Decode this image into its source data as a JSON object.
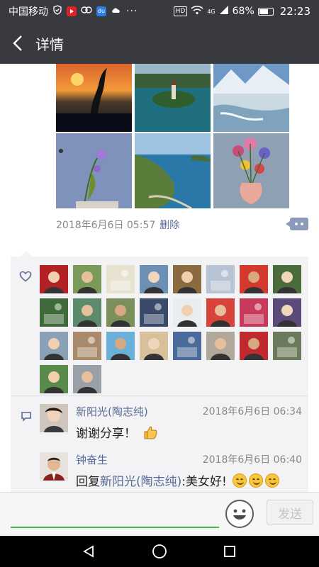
{
  "status_bar": {
    "carrier": "中国移动",
    "hd": "HD",
    "network": "4G",
    "battery": "68%",
    "battery_level": 0.68,
    "time": "22:23",
    "notification_icons": [
      "shield-check-icon",
      "video-app-icon",
      "link-app-icon",
      "baidu-app-icon",
      "weather-app-icon",
      "more-dots-icon"
    ]
  },
  "nav": {
    "title": "详情",
    "back_icon": "back-arrow-icon"
  },
  "post": {
    "photos": [
      "heron-sunset-photo",
      "lake-island-church-photo",
      "glacier-river-photo",
      "purple-flower-arrangement-photo",
      "coastal-headland-photo",
      "flower-vase-photo"
    ],
    "timestamp": "2018年6月6日 05:57",
    "delete_label": "删除",
    "more_icon": "more-options-icon"
  },
  "likes": {
    "icon": "heart-outline-icon",
    "avatars": [
      "freeconstellation-badge-avatar",
      "tower-gate-avatar",
      "tree-sketch-avatar",
      "woman-portrait-avatar",
      "man-smiling-avatar",
      "snowy-scene-avatar",
      "calligraphy-seal-avatar",
      "garden-avatar",
      "bonsai-avatar",
      "waterfall-avatar",
      "man-field-avatar",
      "man-suit-avatar",
      "white-flower-avatar",
      "apples-avatar",
      "red-flower-avatar",
      "woman-smile-avatar",
      "cottage-avatar",
      "woman-longhair-avatar",
      "palm-beach-avatar",
      "beach-people-avatar",
      "dancer-avatar",
      "street-avatar",
      "red-dress-avatar",
      "man-outdoor-avatar",
      "man-glasses-avatar",
      "man-dark-avatar"
    ]
  },
  "comments": {
    "icon": "comment-bubble-icon",
    "items": [
      {
        "name": "新阳光(陶志纯)",
        "time": "2018年6月6日 06:34",
        "text": "谢谢分享！",
        "emoji": "thumbs-up-emoji"
      },
      {
        "name": "钟奋生",
        "time": "2018年6月6日 06:40",
        "reply_prefix": "回复",
        "reply_to": "新阳光(陶志纯)",
        "text": ":美女好!",
        "emoji": "smile-emoji"
      }
    ]
  },
  "input": {
    "value": "",
    "emoji_icon": "emoji-face-icon",
    "send_label": "发送"
  },
  "system_nav": {
    "back_icon": "triangle-back-icon",
    "home_icon": "circle-home-icon",
    "recent_icon": "square-recent-icon"
  },
  "colors": {
    "header": "#393a3f",
    "link": "#576b95",
    "input_underline": "#44b549"
  }
}
